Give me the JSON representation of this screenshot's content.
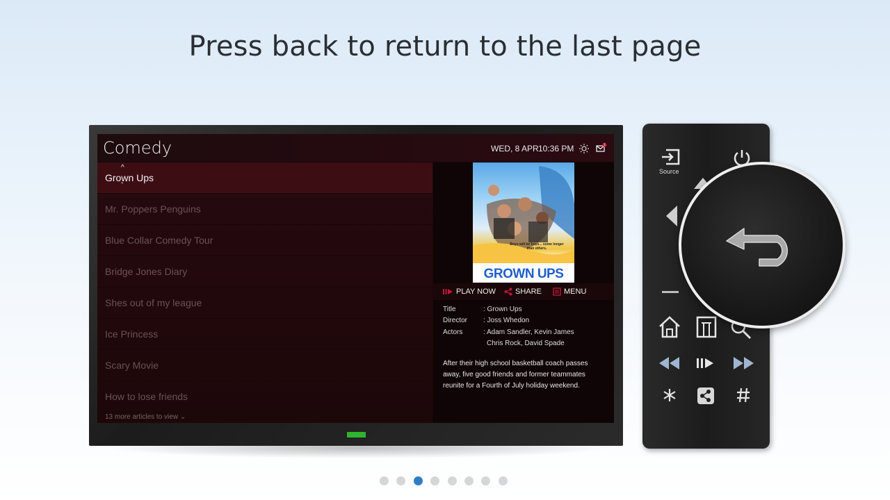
{
  "headline": "Press back to return to the last page",
  "screen": {
    "title": "Comedy",
    "date": "WED, 8 APR",
    "time": "10:36 PM",
    "notification_count": "1",
    "list": [
      {
        "label": "Grown Ups",
        "selected": true
      },
      {
        "label": "Mr. Poppers Penguins"
      },
      {
        "label": "Blue Collar Comedy Tour"
      },
      {
        "label": "Bridge Jones Diary"
      },
      {
        "label": "Shes out of my league"
      },
      {
        "label": "Ice Princess"
      },
      {
        "label": "Scary Movie"
      },
      {
        "label": "How to lose friends"
      }
    ],
    "more_link": "13 more articles to view",
    "poster": {
      "title": "GROWN UPS",
      "tagline": "Boys will be boys... some longer than others."
    },
    "actions": {
      "play": "PLAY NOW",
      "share": "SHARE",
      "menu": "MENU"
    },
    "details": {
      "title_label": "Title",
      "title_value": ": Grown Ups",
      "director_label": "Director",
      "director_value": ": Joss Whedon",
      "actors_label": "Actors",
      "actors_value_1": ": Adam Sandler, Kevin James",
      "actors_value_2": "Chris Rock, David Spade"
    },
    "synopsis": "After their high school basketball coach passes away, five good friends and former teammates reunite for a Fourth of July holiday weekend."
  },
  "remote": {
    "source_label": "Source",
    "buttons": [
      "source-icon",
      "power-icon",
      "back-icon",
      "home-icon",
      "menu-icon",
      "search-icon",
      "rewind-icon",
      "play-pause-icon",
      "fast-forward-icon",
      "asterisk-icon",
      "share-icon",
      "hash-icon"
    ]
  },
  "pagination": {
    "count": 8,
    "active_index": 2
  },
  "colors": {
    "accent_red": "#c3173a",
    "selected_row": "#3c0e14",
    "active_dot": "#2f7ec4",
    "led": "#2db52d"
  }
}
